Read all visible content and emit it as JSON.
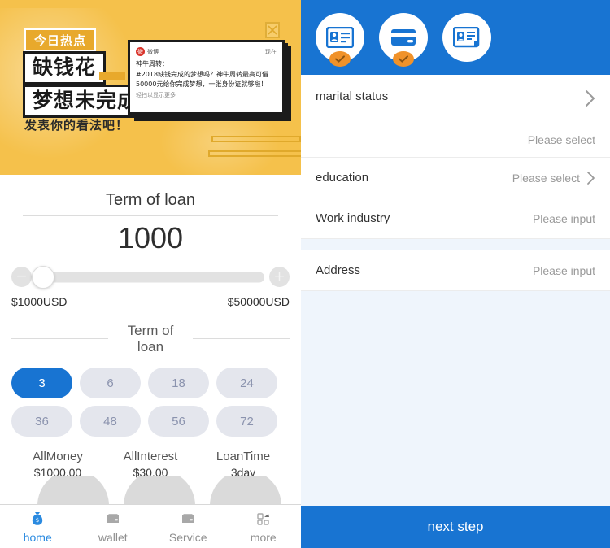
{
  "left": {
    "banner": {
      "badge_hot": "今日热点",
      "title_line1": "缺钱花",
      "title_line2": "梦想未完成",
      "subtitle": "发表你的看法吧！",
      "close_icon": "close-x-icon",
      "bg_color": "#f5c14b",
      "card": {
        "logo_glyph": "微",
        "brand": "微博",
        "time": "现在",
        "title": "神牛周转：",
        "body": "#2018缺钱完成的梦想吗？神牛周转最高可借50000元给你完成梦想，一张身份证就够啦！",
        "more": "轻扫以显示更多"
      }
    },
    "amount": {
      "section_title": "Term of loan",
      "value": "1000",
      "minus_label": "−",
      "plus_label": "+",
      "min_label": "$1000USD",
      "max_label": "$50000USD"
    },
    "term": {
      "section_title": "Term of loan",
      "options": [
        "3",
        "6",
        "18",
        "24",
        "36",
        "48",
        "56",
        "72"
      ],
      "selected": "3",
      "active_color": "#1874d2",
      "inactive_color": "#e4e6ed"
    },
    "summary": [
      {
        "label": "AllMoney",
        "value": "$1000.00"
      },
      {
        "label": "AllInterest",
        "value": "$30.00"
      },
      {
        "label": "LoanTime",
        "value": "3day"
      }
    ],
    "tabs": [
      {
        "label": "home",
        "icon": "money-bag-icon",
        "active": true
      },
      {
        "label": "wallet",
        "icon": "wallet-icon",
        "active": false
      },
      {
        "label": "Service",
        "icon": "service-icon",
        "active": false
      },
      {
        "label": "more",
        "icon": "grid-more-icon",
        "active": false
      }
    ]
  },
  "right": {
    "header": {
      "bg_color": "#1874d2",
      "steps": [
        {
          "icon": "id-card-icon",
          "verified": true
        },
        {
          "icon": "bank-card-icon",
          "verified": true
        },
        {
          "icon": "personal-info-icon",
          "verified": false
        }
      ]
    },
    "form": {
      "rows": [
        {
          "label": "marital status",
          "value": "Please select",
          "control": "select",
          "tall": true
        },
        {
          "label": "education",
          "value": "Please select",
          "control": "select",
          "tall": false
        },
        {
          "label": "Work industry",
          "value": "Please input",
          "control": "input",
          "tall": false
        },
        {
          "label": "Address",
          "value": "Please input",
          "control": "input",
          "tall": false
        }
      ]
    },
    "next_button": "next step"
  }
}
